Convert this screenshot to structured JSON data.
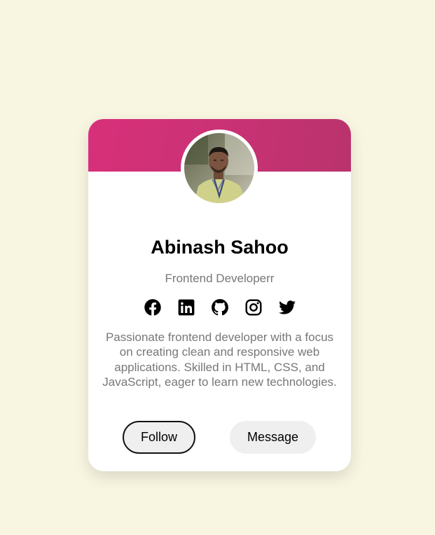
{
  "profile": {
    "name": "Abinash Sahoo",
    "role": "Frontend Developerr",
    "bio": "Passionate frontend developer with a focus on creating clean and responsive web applications. Skilled in HTML, CSS, and JavaScript, eager to learn new technologies."
  },
  "socials": [
    {
      "icon": "facebook-icon"
    },
    {
      "icon": "linkedin-icon"
    },
    {
      "icon": "github-icon"
    },
    {
      "icon": "instagram-icon"
    },
    {
      "icon": "twitter-icon"
    }
  ],
  "actions": {
    "follow_label": "Follow",
    "message_label": "Message"
  },
  "colors": {
    "page_background": "#f8f6e1",
    "banner_start": "#d8307a",
    "banner_end": "#b9336c",
    "card_background": "#ffffff",
    "muted_text": "#777777",
    "button_background": "#efefef"
  }
}
